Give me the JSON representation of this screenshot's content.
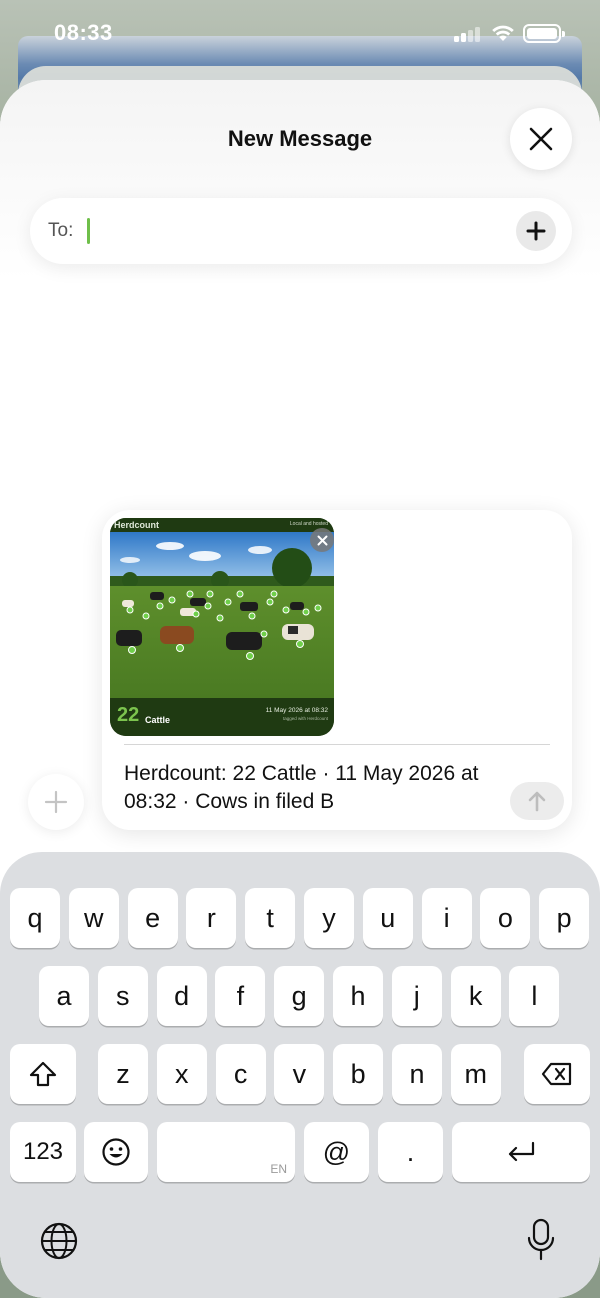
{
  "status_bar": {
    "time": "08:33"
  },
  "sheet": {
    "title": "New Message",
    "to_label": "To:"
  },
  "attachment": {
    "brand": "Herdcount",
    "brand_right": "Local and hosted",
    "count": "22",
    "count_label": "Cattle",
    "date": "11 May 2026 at 08:32",
    "sub": "tagged with Herdcount"
  },
  "message": {
    "text": "Herdcount: 22 Cattle · 11 May 2026 at 08:32 · Cows in filed B"
  },
  "keyboard": {
    "row1": [
      "q",
      "w",
      "e",
      "r",
      "t",
      "y",
      "u",
      "i",
      "o",
      "p"
    ],
    "row2": [
      "a",
      "s",
      "d",
      "f",
      "g",
      "h",
      "j",
      "k",
      "l"
    ],
    "row3": [
      "z",
      "x",
      "c",
      "v",
      "b",
      "n",
      "m"
    ],
    "numbers_key": "123",
    "at_key": "@",
    "dot_key": ".",
    "space_lang": "EN"
  },
  "icons": [
    "close-icon",
    "add-recipient-icon",
    "add-attachment-icon",
    "remove-attachment-icon",
    "send-arrow-icon",
    "shift-icon",
    "delete-icon",
    "emoji-icon",
    "return-icon",
    "globe-icon",
    "mic-icon",
    "signal-icon",
    "wifi-icon",
    "battery-icon"
  ]
}
